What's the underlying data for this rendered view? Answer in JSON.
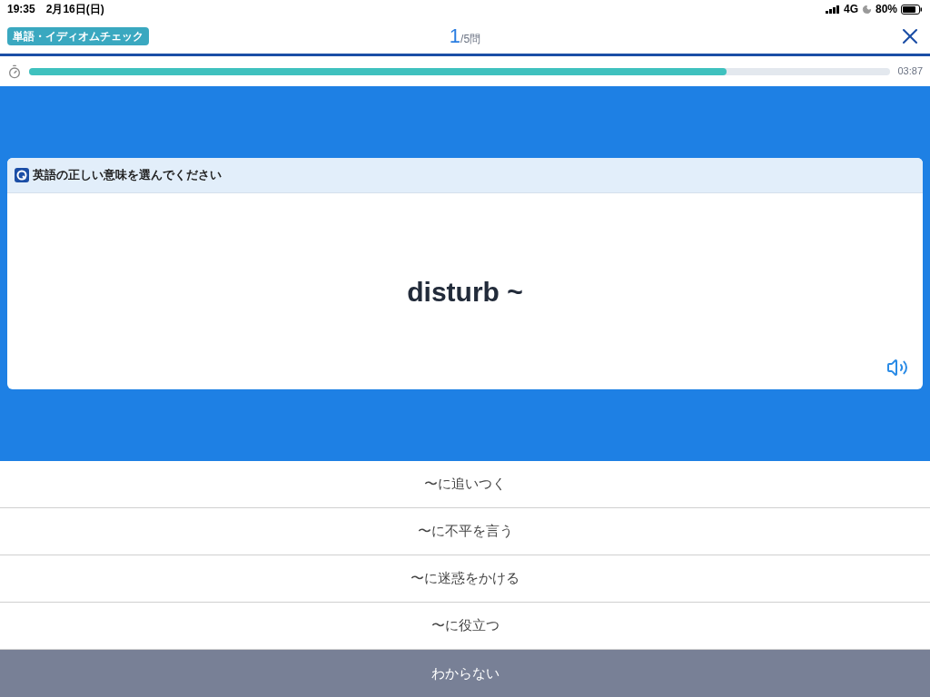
{
  "status_bar": {
    "time": "19:35",
    "date": "2月16日(日)",
    "network": "4G",
    "battery": "80%"
  },
  "header": {
    "tag": "単語・イディオムチェック",
    "current": "1",
    "total": "/5問"
  },
  "timer": {
    "level": 0.81,
    "reading": "03:87"
  },
  "question": {
    "prompt": "英語の正しい意味を選んでください",
    "word": "disturb ~"
  },
  "options": [
    {
      "label": "〜に追いつく"
    },
    {
      "label": "〜に不平を言う"
    },
    {
      "label": "〜に迷惑をかける"
    },
    {
      "label": "〜に役立つ"
    }
  ],
  "skip_button": "わからない"
}
